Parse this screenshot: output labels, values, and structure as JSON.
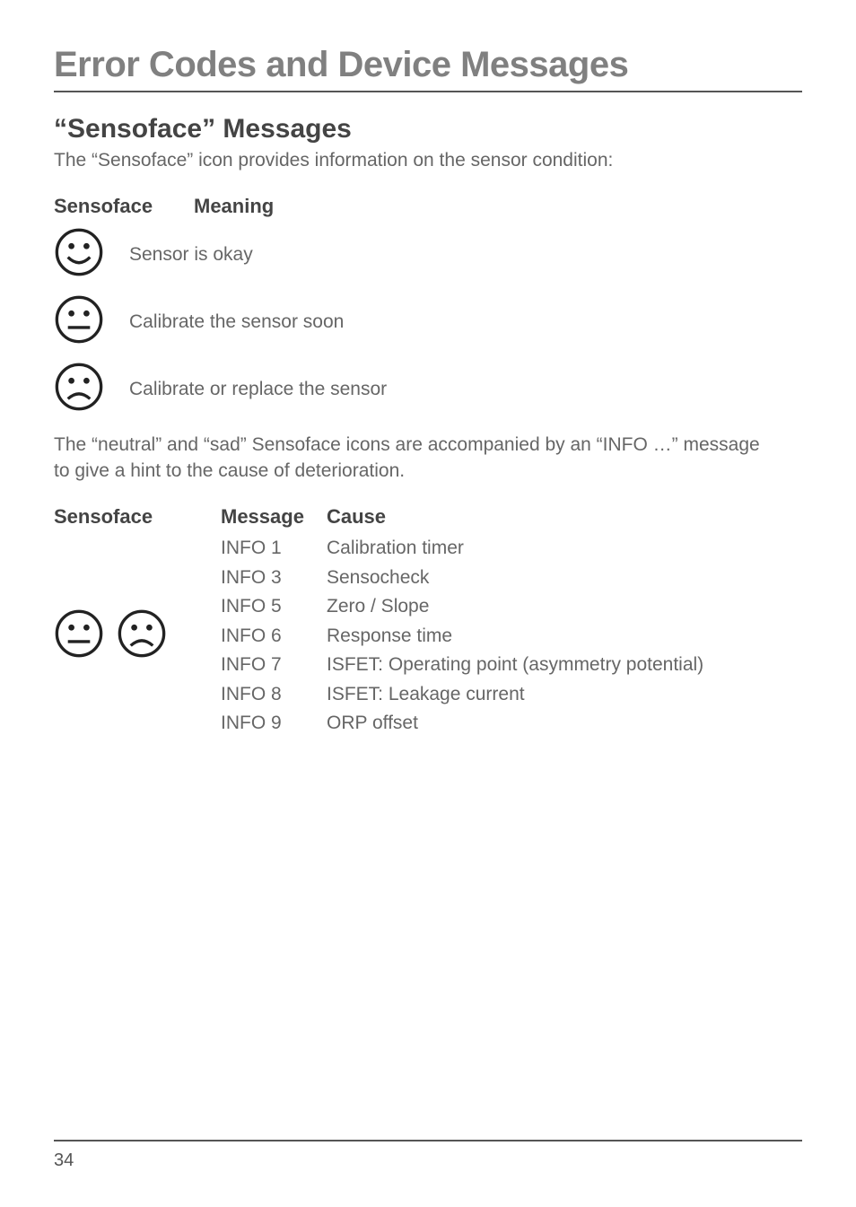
{
  "title": "Error Codes and Device Messages",
  "section": {
    "heading": "“Sensoface” Messages",
    "intro": "The “Sensoface” icon provides information on the sensor condition:"
  },
  "meaningTable": {
    "headers": {
      "col1": "Sensoface",
      "col2": "Meaning"
    },
    "rows": [
      {
        "icon": "face-happy-icon",
        "text": "Sensor is okay"
      },
      {
        "icon": "face-neutral-icon",
        "text": "Calibrate the sensor soon"
      },
      {
        "icon": "face-sad-icon",
        "text": "Calibrate or replace the sensor"
      }
    ]
  },
  "note": {
    "line1": "The “neutral” and “sad” Sensoface icons are accompanied by an “INFO …” message",
    "line2": "to give a hint to the cause of deterioration."
  },
  "causeTable": {
    "headers": {
      "c1": "Sensoface",
      "c2": "Message",
      "c3": "Cause"
    },
    "rows": [
      {
        "msg": "INFO 1",
        "cause": "Calibration timer"
      },
      {
        "msg": "INFO 3",
        "cause": "Sensocheck"
      },
      {
        "msg": "INFO 5",
        "cause": "Zero / Slope"
      },
      {
        "msg": "INFO 6",
        "cause": "Response time"
      },
      {
        "msg": "INFO 7",
        "cause": "ISFET: Operating point (asymmetry potential)"
      },
      {
        "msg": "INFO 8",
        "cause": "ISFET: Leakage current"
      },
      {
        "msg": "INFO 9",
        "cause": "ORP offset"
      }
    ]
  },
  "pageNumber": "34"
}
